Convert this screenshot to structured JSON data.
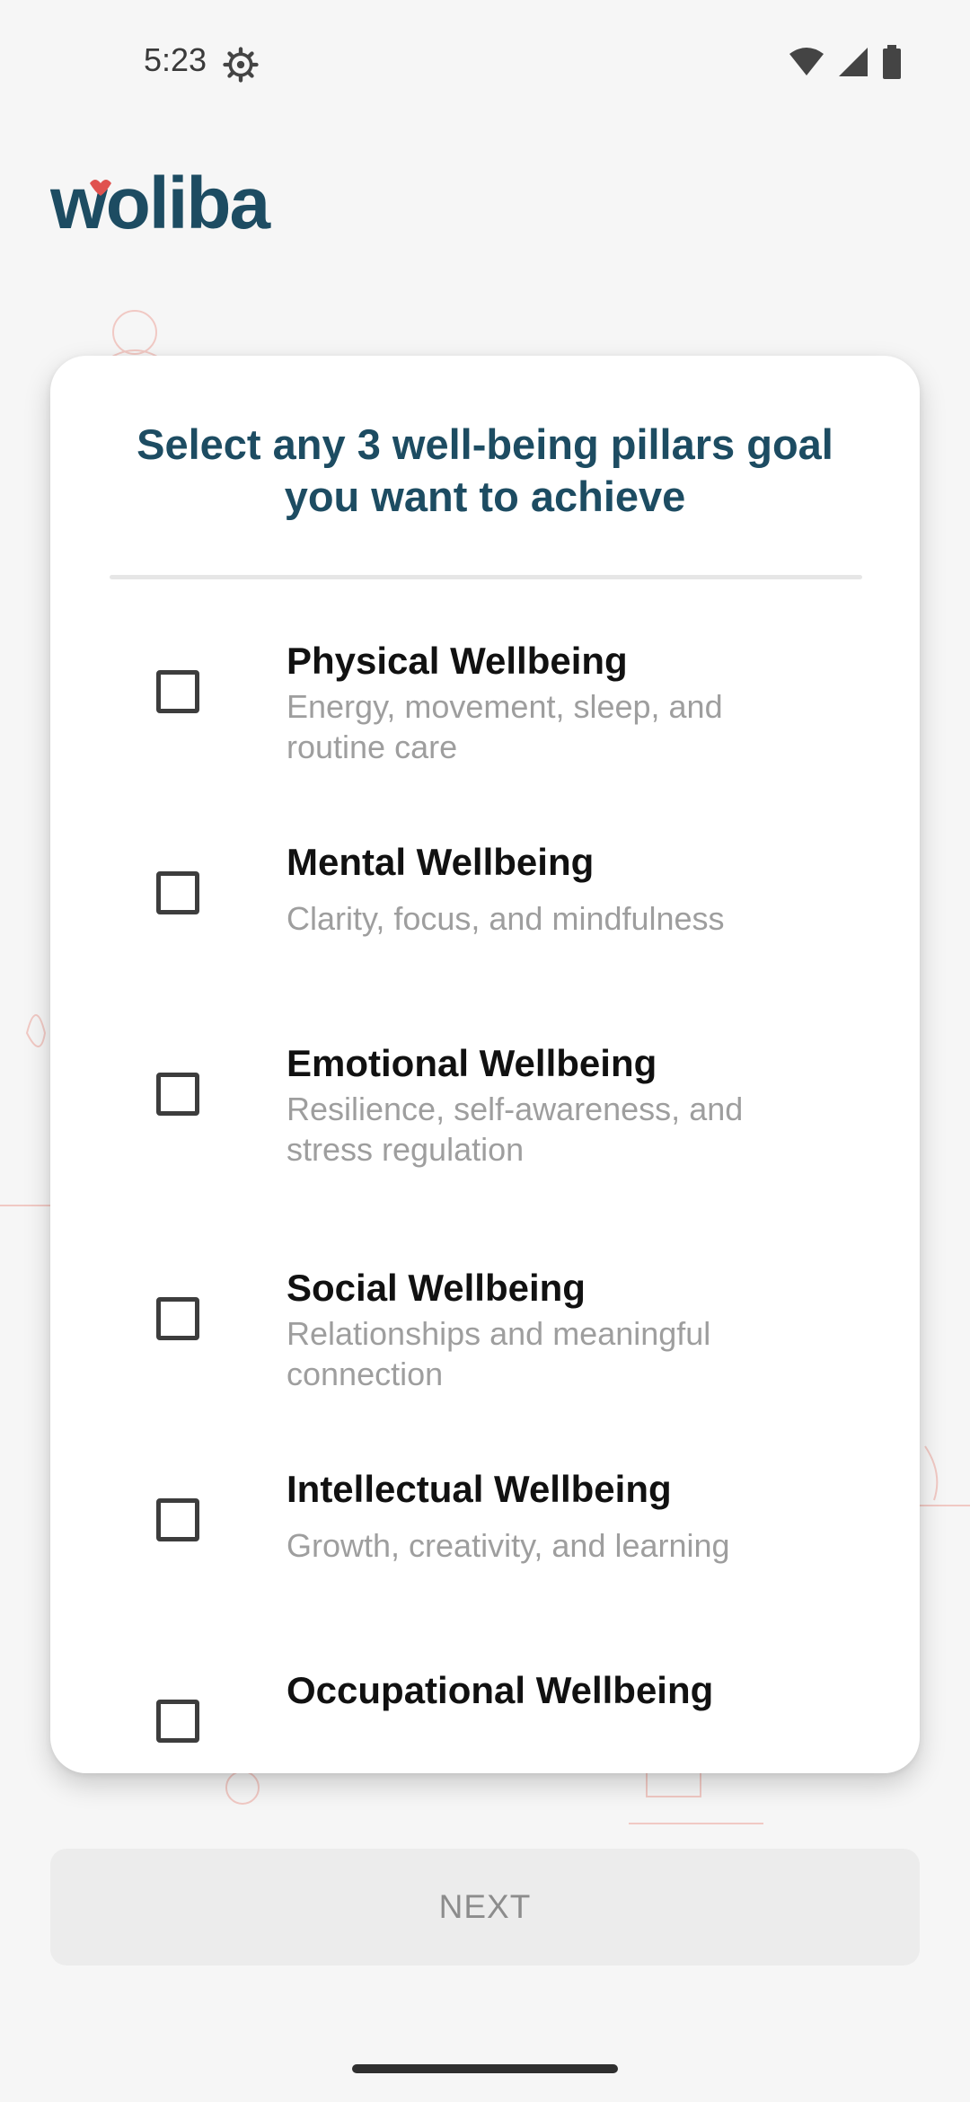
{
  "status_bar": {
    "time": "5:23",
    "icons": [
      "settings-icon",
      "wifi-icon",
      "signal-icon",
      "battery-icon"
    ]
  },
  "brand": {
    "logo_text": "woliba",
    "logo_color": "#1d4c62",
    "accent_color": "#e0524f"
  },
  "card": {
    "title": "Select any 3 well-being pillars goal you want to achieve",
    "items": [
      {
        "title": "Physical Wellbeing",
        "description": "Energy, movement, sleep, and routine care",
        "checked": false
      },
      {
        "title": "Mental Wellbeing",
        "description": "Clarity, focus, and mindfulness",
        "checked": false
      },
      {
        "title": "Emotional Wellbeing",
        "description": "Resilience, self-awareness, and stress regulation",
        "checked": false
      },
      {
        "title": "Social Wellbeing",
        "description": "Relationships and meaningful connection",
        "checked": false
      },
      {
        "title": "Intellectual Wellbeing",
        "description": "Growth, creativity, and learning",
        "checked": false
      },
      {
        "title": "Occupational Wellbeing",
        "description": "",
        "checked": false
      }
    ]
  },
  "footer": {
    "next_label": "NEXT"
  }
}
